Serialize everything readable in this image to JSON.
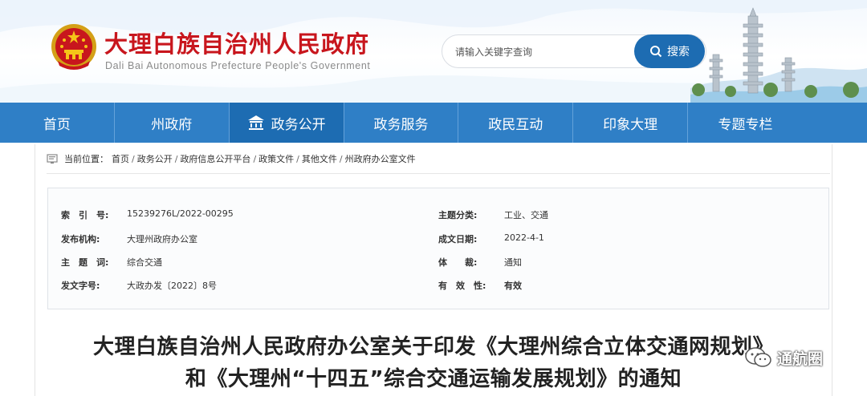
{
  "header": {
    "site_title": "大理白族自治州人民政府",
    "site_subtitle": "Dali Bai Autonomous Prefecture People's Government",
    "search_placeholder": "请输入关键字查询",
    "search_button": "搜索",
    "brand_color": "#c8161d",
    "accent_color": "#1d6cb2"
  },
  "nav": {
    "items": [
      {
        "label": "首页"
      },
      {
        "label": "州政府"
      },
      {
        "label": "政务公开",
        "active": true
      },
      {
        "label": "政务服务"
      },
      {
        "label": "政民互动"
      },
      {
        "label": "印象大理"
      },
      {
        "label": "专题专栏"
      }
    ]
  },
  "breadcrumb": {
    "prefix": "当前位置：",
    "items": [
      "首页",
      "政务公开",
      "政府信息公开平台",
      "政策文件",
      "其他文件",
      "州政府办公室文件"
    ]
  },
  "info": {
    "index_key": "索　引　号:",
    "index_val": "15239276L/2022-00295",
    "org_key": "发布机构:",
    "org_val": "大理州政府办公室",
    "subject_key": "主　题　词:",
    "subject_val": "综合交通",
    "docno_key": "发文字号:",
    "docno_val": "大政办发〔2022〕8号",
    "category_key": "主题分类:",
    "category_val": "工业、交通",
    "date_key": "成文日期:",
    "date_val": "2022-4-1",
    "genre_key": "体　　裁:",
    "genre_val": "通知",
    "validity_key": "有　效　性:",
    "validity_val": "有效"
  },
  "title": {
    "line1": "大理白族自治州人民政府办公室关于印发《大理州综合立体交通网规划》",
    "line2": "和《大理州“十四五”综合交通运输发展规划》的通知"
  },
  "watermark": {
    "text": "通航圈"
  }
}
